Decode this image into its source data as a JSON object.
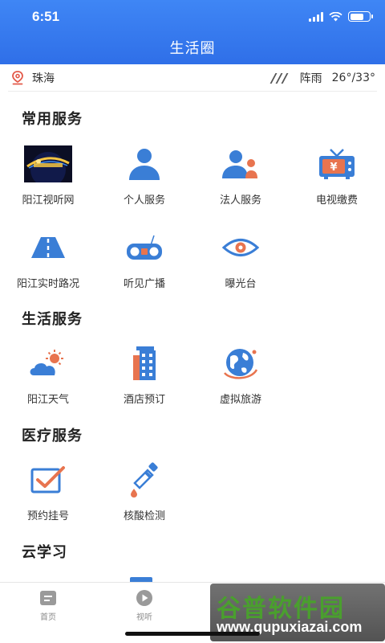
{
  "status": {
    "time": "6:51"
  },
  "header": {
    "title": "生活圈"
  },
  "location": {
    "city": "珠海",
    "weather": "阵雨",
    "temperature": "26°/33°"
  },
  "sections": [
    {
      "title": "常用服务",
      "items": [
        {
          "label": "阳江视听网",
          "icon": "yangjiang-media-logo"
        },
        {
          "label": "个人服务",
          "icon": "person-icon"
        },
        {
          "label": "法人服务",
          "icon": "legal-person-icon"
        },
        {
          "label": "电视缴费",
          "icon": "tv-payment-icon"
        },
        {
          "label": "阳江实时路况",
          "icon": "road-icon"
        },
        {
          "label": "听见广播",
          "icon": "radio-icon"
        },
        {
          "label": "曝光台",
          "icon": "eye-icon"
        }
      ]
    },
    {
      "title": "生活服务",
      "items": [
        {
          "label": "阳江天气",
          "icon": "weather-icon"
        },
        {
          "label": "酒店预订",
          "icon": "hotel-icon"
        },
        {
          "label": "虚拟旅游",
          "icon": "globe-icon"
        }
      ]
    },
    {
      "title": "医疗服务",
      "items": [
        {
          "label": "预约挂号",
          "icon": "checkbox-icon"
        },
        {
          "label": "核酸检测",
          "icon": "dropper-icon"
        }
      ]
    },
    {
      "title": "云学习",
      "items": []
    }
  ],
  "tabs": [
    {
      "label": "首页",
      "icon": "home-doc-icon"
    },
    {
      "label": "视听",
      "icon": "play-icon"
    }
  ],
  "watermark": {
    "name": "谷普软件园",
    "url": "www.gupuxiazai.com"
  },
  "colors": {
    "primary": "#3a7cf0",
    "accent": "#e8744f",
    "icon_blue": "#3a7ed6"
  }
}
